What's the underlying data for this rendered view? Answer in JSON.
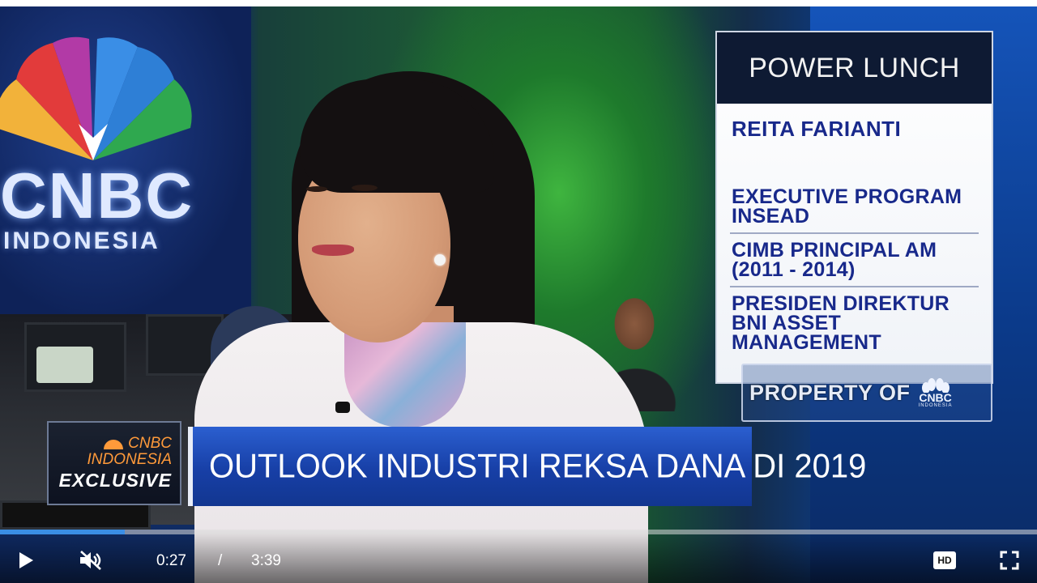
{
  "studio": {
    "logo_main": "CNBC",
    "logo_sub": "INDONESIA"
  },
  "lower_third": {
    "program": "POWER LUNCH",
    "guest_name": "REITA FARIANTI",
    "credentials": [
      {
        "line1": "EXECUTIVE PROGRAM",
        "line2": "INSEAD"
      },
      {
        "line1": "CIMB PRINCIPAL AM",
        "line2": "(2011 - 2014)"
      },
      {
        "line1": "PRESIDEN DIREKTUR",
        "line2": "BNI ASSET MANAGEMENT"
      }
    ],
    "property_text": "PROPERTY OF",
    "property_logo_main": "CNBC",
    "property_logo_sub": "INDONESIA"
  },
  "headline": {
    "brand_main": "CNBC",
    "brand_sub": "INDONESIA",
    "exclusive_label": "EXCLUSIVE",
    "title": "OUTLOOK INDUSTRI REKSA DANA DI 2019"
  },
  "player": {
    "current_time": "0:27",
    "separator": "/",
    "duration": "3:39",
    "progress_percent": 12,
    "hd_label": "HD",
    "icons": {
      "play": "play-icon",
      "mute": "muted-speaker-icon",
      "hd": "hd-icon",
      "fullscreen": "fullscreen-icon"
    },
    "colors": {
      "progress": "#3a8ee6"
    }
  }
}
